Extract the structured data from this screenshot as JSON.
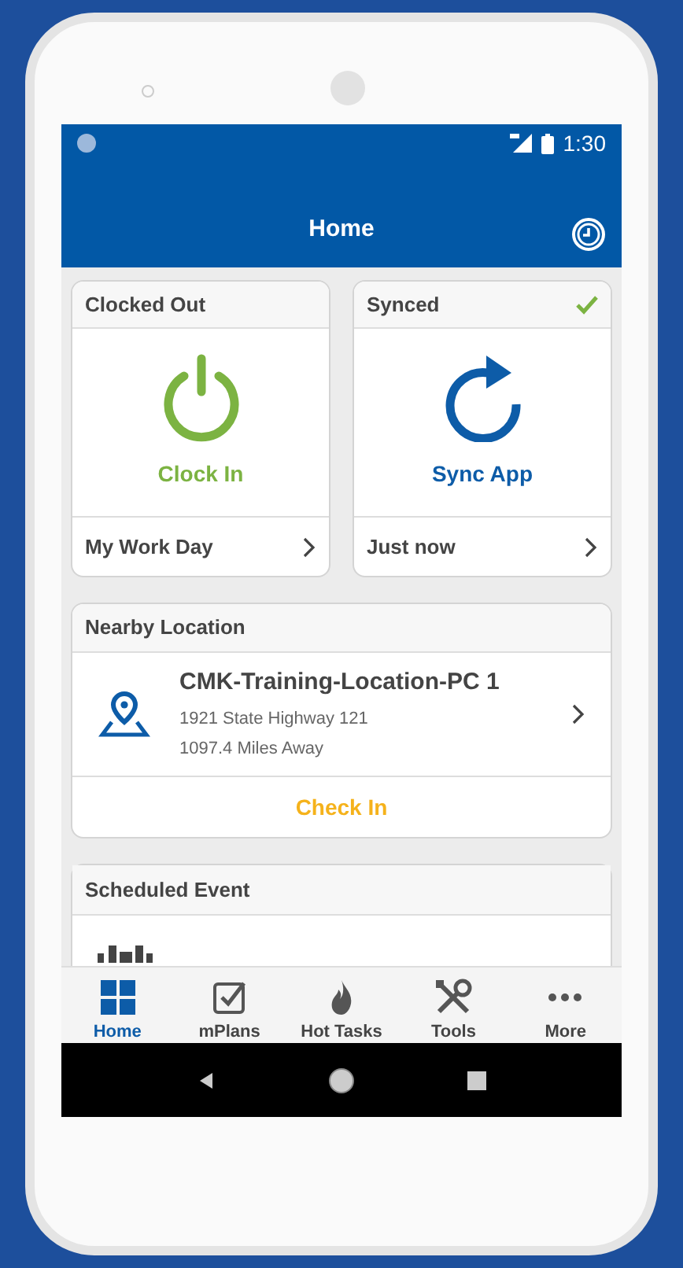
{
  "status_bar": {
    "time": "1:30"
  },
  "app_bar": {
    "title": "Home"
  },
  "tiles": [
    {
      "kind": "clock",
      "header": "Clocked Out",
      "synced": false,
      "action": "Clock In",
      "footer": "My Work Day"
    },
    {
      "kind": "sync",
      "header": "Synced",
      "synced": true,
      "action": "Sync App",
      "footer": "Just now"
    }
  ],
  "nearby_location": {
    "header": "Nearby Location",
    "name": "CMK-Training-Location-PC 1",
    "address": "1921 State Highway 121",
    "distance": "1097.4 Miles Away",
    "action": "Check In"
  },
  "scheduled_event": {
    "header": "Scheduled Event"
  },
  "bottom_nav": [
    {
      "kind": "home",
      "label": "Home",
      "selected": true
    },
    {
      "kind": "plans",
      "label": "mPlans",
      "selected": false
    },
    {
      "kind": "hot",
      "label": "Hot Tasks",
      "selected": false
    },
    {
      "kind": "tools",
      "label": "Tools",
      "selected": false
    },
    {
      "kind": "more",
      "label": "More",
      "selected": false
    }
  ]
}
